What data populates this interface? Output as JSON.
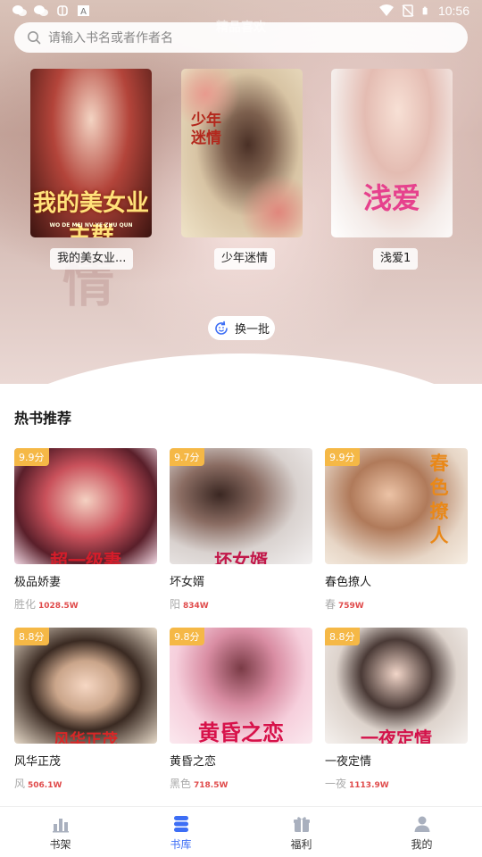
{
  "status_bar": {
    "time": "10:56"
  },
  "search": {
    "placeholder": "请输入书名或者作者名",
    "overlay_label": "精品喜欢"
  },
  "featured": [
    {
      "title": "我的美女业...",
      "cover_text": "我的美女业主群",
      "cover_sub": "WO DE MEI NV YE ZHU QUN"
    },
    {
      "title": "少年迷情",
      "cover_text": "少年迷情"
    },
    {
      "title": "浅爱1",
      "cover_text": "浅爱"
    }
  ],
  "refresh": {
    "label": "换一批"
  },
  "hot_section": {
    "title": "热书推荐",
    "books": [
      {
        "title": "极品娇妻",
        "rating": "9.9分",
        "author": "胜化",
        "count": "1028.5W",
        "cover_text": "超一级妻"
      },
      {
        "title": "坏女婿",
        "rating": "9.7分",
        "author": "阳",
        "count": "834W",
        "cover_text": "坏女婿"
      },
      {
        "title": "春色撩人",
        "rating": "9.9分",
        "author": "春",
        "count": "759W",
        "cover_text": "春色撩人"
      },
      {
        "title": "风华正茂",
        "rating": "8.8分",
        "author": "风",
        "count": "506.1W",
        "cover_text": "风华正茂"
      },
      {
        "title": "黄昏之恋",
        "rating": "9.8分",
        "author": "黑色",
        "count": "718.5W",
        "cover_text": "黄昏之恋"
      },
      {
        "title": "一夜定情",
        "rating": "8.8分",
        "author": "一夜",
        "count": "1113.9W",
        "cover_text": "一夜定情"
      }
    ]
  },
  "nav": {
    "items": [
      {
        "label": "书架",
        "icon": "bar-chart-icon"
      },
      {
        "label": "书库",
        "icon": "stack-icon"
      },
      {
        "label": "福利",
        "icon": "gift-icon"
      },
      {
        "label": "我的",
        "icon": "user-icon"
      }
    ],
    "active_index": 1
  },
  "colors": {
    "accent": "#3d6ef5",
    "rating_badge": "#f5b846",
    "count_red": "#e04b4b"
  }
}
